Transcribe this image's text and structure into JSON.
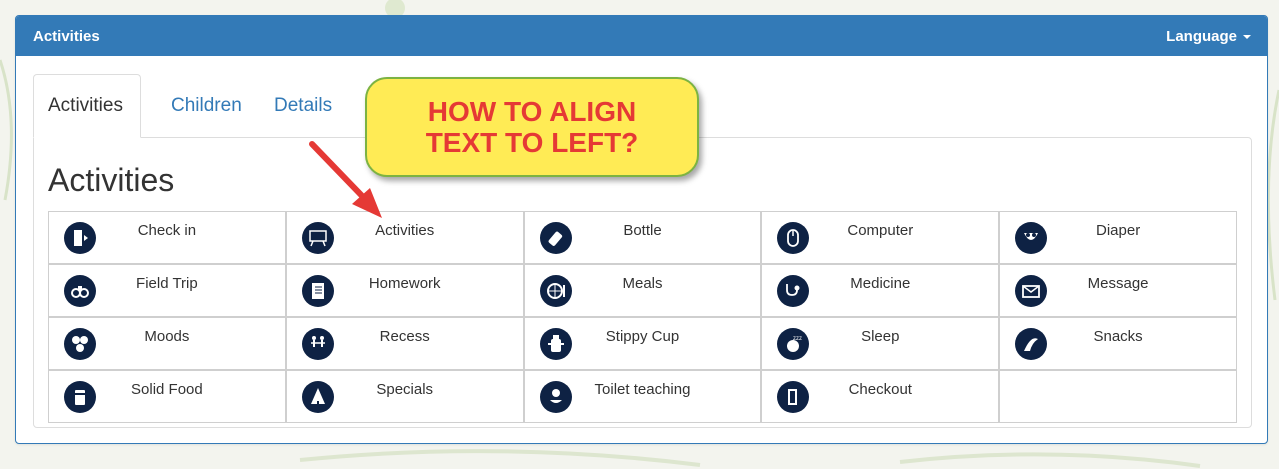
{
  "panel": {
    "title": "Activities",
    "language_label": "Language"
  },
  "tabs": [
    {
      "label": "Activities",
      "active": true
    },
    {
      "label": "Children",
      "active": false
    },
    {
      "label": "Details",
      "active": false
    }
  ],
  "pane": {
    "title": "Activities"
  },
  "activities": [
    {
      "label": "Check in",
      "icon": "door-enter-icon"
    },
    {
      "label": "Activities",
      "icon": "easel-icon"
    },
    {
      "label": "Bottle",
      "icon": "bottle-icon"
    },
    {
      "label": "Computer",
      "icon": "mouse-icon"
    },
    {
      "label": "Diaper",
      "icon": "diaper-icon"
    },
    {
      "label": "Field Trip",
      "icon": "binoculars-icon"
    },
    {
      "label": "Homework",
      "icon": "notebook-icon"
    },
    {
      "label": "Meals",
      "icon": "plate-icon"
    },
    {
      "label": "Medicine",
      "icon": "stethoscope-icon"
    },
    {
      "label": "Message",
      "icon": "envelope-icon"
    },
    {
      "label": "Moods",
      "icon": "faces-icon"
    },
    {
      "label": "Recess",
      "icon": "kids-playing-icon"
    },
    {
      "label": "Stippy Cup",
      "icon": "sippy-cup-icon"
    },
    {
      "label": "Sleep",
      "icon": "sleeping-baby-icon"
    },
    {
      "label": "Snacks",
      "icon": "snack-icon"
    },
    {
      "label": "Solid Food",
      "icon": "food-jar-icon"
    },
    {
      "label": "Specials",
      "icon": "tree-icon"
    },
    {
      "label": "Toilet teaching",
      "icon": "potty-icon"
    },
    {
      "label": "Checkout",
      "icon": "door-exit-icon"
    },
    {
      "label": "",
      "icon": ""
    }
  ],
  "callout": {
    "line1": "HOW TO ALIGN",
    "line2": "TEXT TO LEFT?"
  },
  "colors": {
    "primary": "#337ab7",
    "icon_bg": "#0e2244",
    "callout_bg": "#ffeb55",
    "callout_text": "#e53935",
    "callout_border": "#7cb342",
    "arrow": "#e53935"
  }
}
